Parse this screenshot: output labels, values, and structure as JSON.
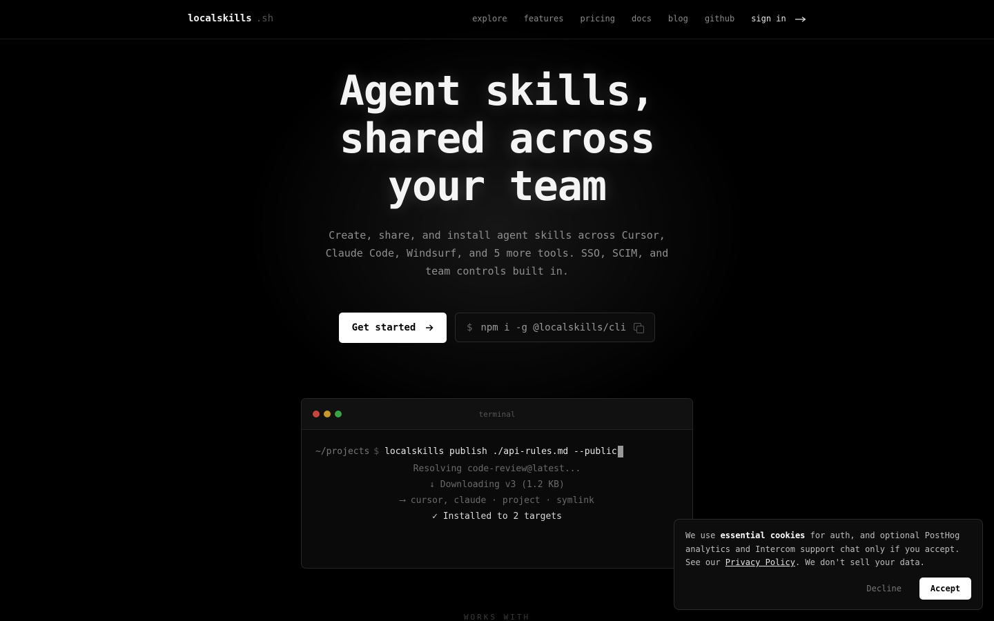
{
  "nav": {
    "brand": "localskills",
    "brand_tld": ".sh",
    "links": [
      "explore",
      "features",
      "pricing",
      "docs",
      "blog",
      "github"
    ],
    "signin": "sign in",
    "signin_icon": "arrow-right-icon"
  },
  "hero": {
    "title_lines": [
      "Agent skills,",
      "shared across",
      "your team"
    ],
    "subtitle": "Create, share, and install agent skills across Cursor, Claude Code, Windsurf, and 5 more tools. SSO, SCIM, and team controls built in.",
    "cta_label": "Get started",
    "install_prompt": "$",
    "install_command": "npm i -g @localskills/cli"
  },
  "terminal": {
    "title": "terminal",
    "path": "~/projects",
    "dollar": "$",
    "command": "localskills publish ./api-rules.md --public",
    "output": [
      "Resolving code-review@latest...",
      "↓ Downloading v3 (1.2 KB)",
      "⟶ cursor, claude · project · symlink"
    ],
    "success": "✓ Installed to 2 targets",
    "dot_colors": [
      "#c8453f",
      "#c8962b",
      "#3aa347"
    ]
  },
  "works_with": "WORKS WITH",
  "cookie": {
    "t1": "We use ",
    "bold": "essential cookies",
    "t2": " for auth, and optional PostHog analytics and Intercom support chat only if you accept. See our ",
    "link": "Privacy Policy",
    "t3": ". We don't sell your data.",
    "decline": "Decline",
    "accept": "Accept"
  }
}
